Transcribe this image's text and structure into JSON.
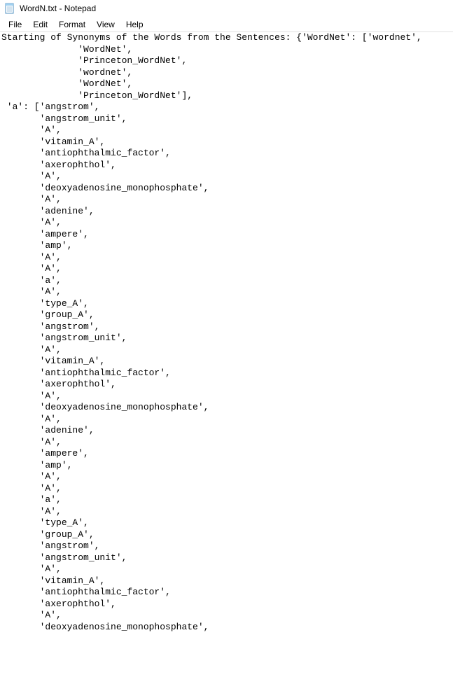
{
  "window": {
    "title": "WordN.txt - Notepad"
  },
  "menu": {
    "file": "File",
    "edit": "Edit",
    "format": "Format",
    "view": "View",
    "help": "Help"
  },
  "content": {
    "lines": [
      "Starting of Synonyms of the Words from the Sentences: {'WordNet': ['wordnet',",
      "              'WordNet',",
      "              'Princeton_WordNet',",
      "              'wordnet',",
      "              'WordNet',",
      "              'Princeton_WordNet'],",
      " 'a': ['angstrom',",
      "       'angstrom_unit',",
      "       'A',",
      "       'vitamin_A',",
      "       'antiophthalmic_factor',",
      "       'axerophthol',",
      "       'A',",
      "       'deoxyadenosine_monophosphate',",
      "       'A',",
      "       'adenine',",
      "       'A',",
      "       'ampere',",
      "       'amp',",
      "       'A',",
      "       'A',",
      "       'a',",
      "       'A',",
      "       'type_A',",
      "       'group_A',",
      "       'angstrom',",
      "       'angstrom_unit',",
      "       'A',",
      "       'vitamin_A',",
      "       'antiophthalmic_factor',",
      "       'axerophthol',",
      "       'A',",
      "       'deoxyadenosine_monophosphate',",
      "       'A',",
      "       'adenine',",
      "       'A',",
      "       'ampere',",
      "       'amp',",
      "       'A',",
      "       'A',",
      "       'a',",
      "       'A',",
      "       'type_A',",
      "       'group_A',",
      "       'angstrom',",
      "       'angstrom_unit',",
      "       'A',",
      "       'vitamin_A',",
      "       'antiophthalmic_factor',",
      "       'axerophthol',",
      "       'A',",
      "       'deoxyadenosine_monophosphate',"
    ]
  }
}
